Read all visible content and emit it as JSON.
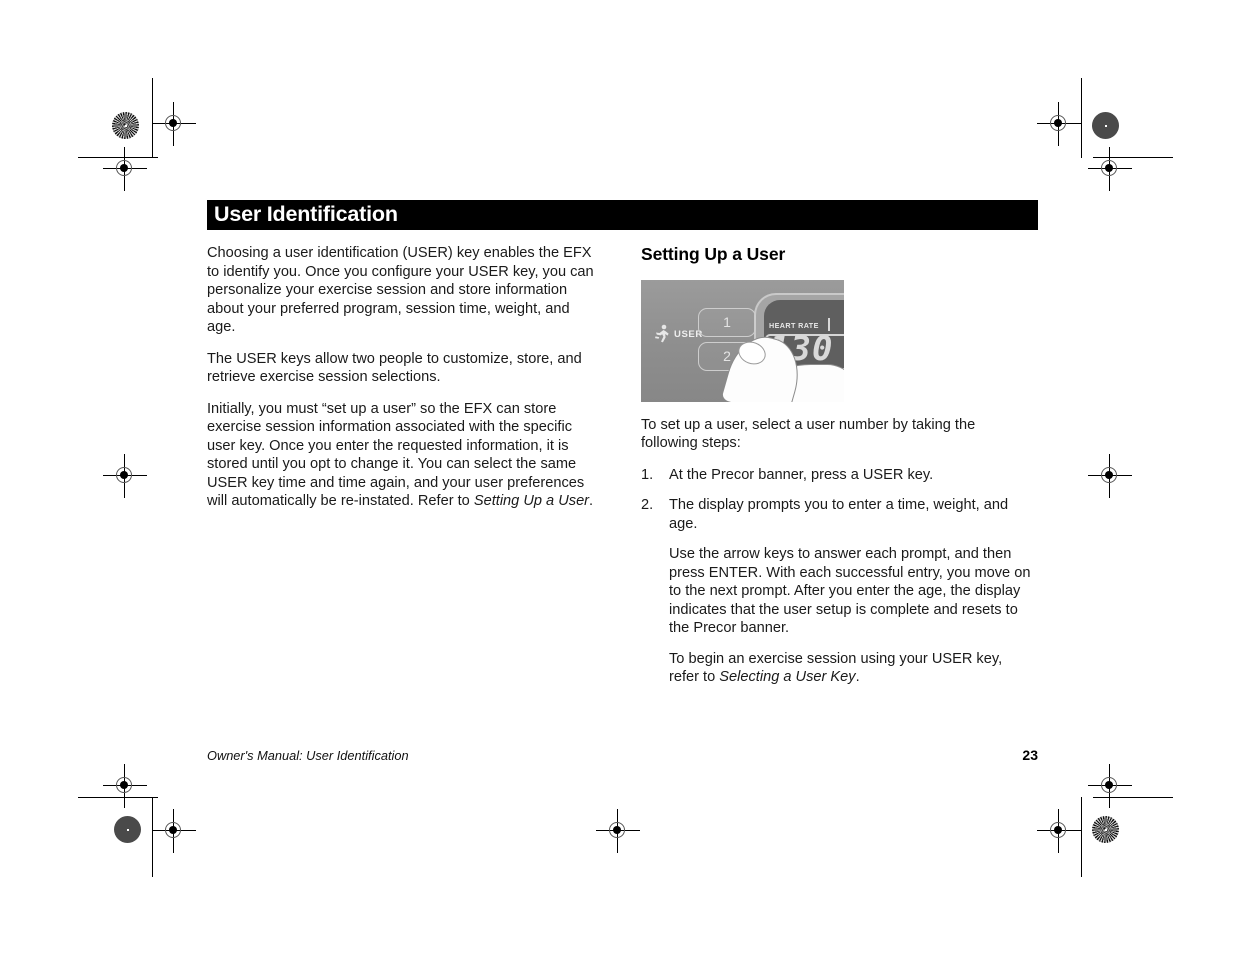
{
  "document": {
    "title": "User Identification",
    "page_number": "23",
    "footer_text": "Owner's Manual: User Identification"
  },
  "left_column": {
    "paragraphs": [
      "Choosing a user identification (USER) key enables the EFX to identify you. Once you configure your USER key, you can personalize your exercise session and store information about your preferred program, session time, weight, and age.",
      "The USER keys allow two people to customize, store, and retrieve exercise session selections."
    ],
    "paragraph3_part1": "Initially, you must “set up a user” so the EFX can store exercise session information associated with the specific user key. Once you enter the requested information, it is stored until you opt to change it. You can select the same USER key time and time again, and your user preferences will automatically be re-instated. Refer to ",
    "paragraph3_italic": "Setting Up a User",
    "paragraph3_part2": "."
  },
  "right_column": {
    "heading": "Setting Up a User",
    "intro": "To set up a user, select a user number by taking the following steps:",
    "steps": [
      {
        "num": "1.",
        "text": "At the Precor banner, press a USER key."
      },
      {
        "num": "2.",
        "text": "The display prompts you to enter a time, weight, and age."
      }
    ],
    "substep1": "Use the arrow keys to answer each prompt, and then press ENTER. With each successful entry, you move on to the next prompt. After you enter the age, the display indicates that the user setup is complete and resets to the Precor banner.",
    "substep2_part1": "To begin an exercise session using your USER key, refer to ",
    "substep2_italic": "Selecting a User Key",
    "substep2_part2": "."
  },
  "console_image": {
    "user_label": "USER",
    "key1_label": "1",
    "key2_label": "2",
    "heart_rate_label": "HEART RATE",
    "heart_rate_value": "130",
    "runner_icon": "runner-icon",
    "heart_icon": "♥"
  },
  "colors": {
    "title_bar_background": "#000000",
    "title_bar_text": "#ffffff",
    "body_text": "#1a1a1a",
    "console_panel": "#8e8e8e",
    "console_screen": "#5f5f5f",
    "lcd_digits": "#d9d9d9"
  }
}
